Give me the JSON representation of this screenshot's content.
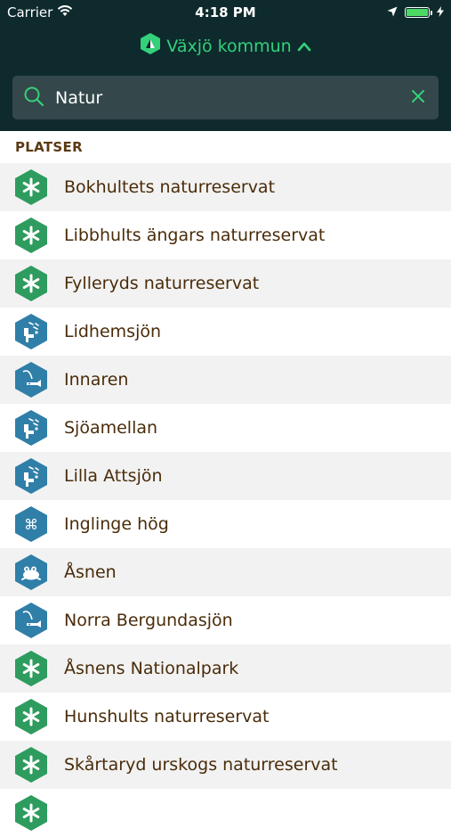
{
  "status": {
    "carrier": "Carrier",
    "time": "4:18 PM"
  },
  "header": {
    "title": "Växjö kommun"
  },
  "search": {
    "value": "Natur"
  },
  "section": {
    "title": "PLATSER"
  },
  "colors": {
    "green": "#2e9c5e",
    "blue": "#2f7fa8",
    "header_bg": "#0e2a2d",
    "accent": "#33d17a"
  },
  "items": [
    {
      "label": "Bokhultets naturreservat",
      "icon": "nature-reserve-icon",
      "color": "green"
    },
    {
      "label": "Libbhults ängars naturreservat",
      "icon": "nature-reserve-icon",
      "color": "green"
    },
    {
      "label": "Fylleryds naturreservat",
      "icon": "nature-reserve-icon",
      "color": "green"
    },
    {
      "label": "Lidhemsjön",
      "icon": "birdwatching-icon",
      "color": "blue"
    },
    {
      "label": "Innaren",
      "icon": "fishing-icon",
      "color": "blue"
    },
    {
      "label": "Sjöamellan",
      "icon": "birdwatching-icon",
      "color": "blue"
    },
    {
      "label": "Lilla Attsjön",
      "icon": "birdwatching-icon",
      "color": "blue"
    },
    {
      "label": "Inglinge hög",
      "icon": "sight-icon",
      "color": "blue"
    },
    {
      "label": "Åsnen",
      "icon": "frog-icon",
      "color": "blue"
    },
    {
      "label": "Norra Bergundasjön",
      "icon": "fishing-icon",
      "color": "blue"
    },
    {
      "label": "Åsnens Nationalpark",
      "icon": "nature-reserve-icon",
      "color": "green"
    },
    {
      "label": "Hunshults naturreservat",
      "icon": "nature-reserve-icon",
      "color": "green"
    },
    {
      "label": "Skårtaryd urskogs naturreservat",
      "icon": "nature-reserve-icon",
      "color": "green"
    },
    {
      "label": "",
      "icon": "nature-reserve-icon",
      "color": "green"
    }
  ]
}
